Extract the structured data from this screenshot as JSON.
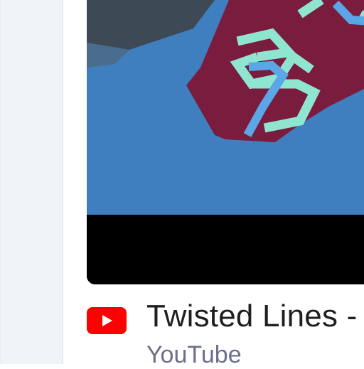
{
  "result": {
    "title": "Twisted Lines -",
    "source": "YouTube",
    "source_icon": "youtube-logo-icon"
  },
  "colors": {
    "youtube_red": "#ff0000",
    "title_text": "#1f1f1f",
    "source_text": "#6b6f8a",
    "panel_bg": "#f0f4f8"
  }
}
